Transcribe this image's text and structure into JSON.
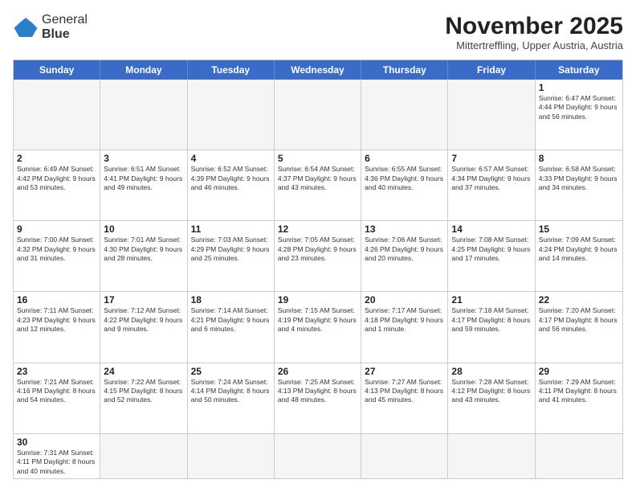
{
  "header": {
    "logo_line1": "General",
    "logo_line2": "Blue",
    "month_title": "November 2025",
    "subtitle": "Mittertreffling, Upper Austria, Austria"
  },
  "days_of_week": [
    "Sunday",
    "Monday",
    "Tuesday",
    "Wednesday",
    "Thursday",
    "Friday",
    "Saturday"
  ],
  "weeks": [
    [
      {
        "num": "",
        "info": ""
      },
      {
        "num": "",
        "info": ""
      },
      {
        "num": "",
        "info": ""
      },
      {
        "num": "",
        "info": ""
      },
      {
        "num": "",
        "info": ""
      },
      {
        "num": "",
        "info": ""
      },
      {
        "num": "1",
        "info": "Sunrise: 6:47 AM\nSunset: 4:44 PM\nDaylight: 9 hours and 56 minutes."
      }
    ],
    [
      {
        "num": "2",
        "info": "Sunrise: 6:49 AM\nSunset: 4:42 PM\nDaylight: 9 hours and 53 minutes."
      },
      {
        "num": "3",
        "info": "Sunrise: 6:51 AM\nSunset: 4:41 PM\nDaylight: 9 hours and 49 minutes."
      },
      {
        "num": "4",
        "info": "Sunrise: 6:52 AM\nSunset: 4:39 PM\nDaylight: 9 hours and 46 minutes."
      },
      {
        "num": "5",
        "info": "Sunrise: 6:54 AM\nSunset: 4:37 PM\nDaylight: 9 hours and 43 minutes."
      },
      {
        "num": "6",
        "info": "Sunrise: 6:55 AM\nSunset: 4:36 PM\nDaylight: 9 hours and 40 minutes."
      },
      {
        "num": "7",
        "info": "Sunrise: 6:57 AM\nSunset: 4:34 PM\nDaylight: 9 hours and 37 minutes."
      },
      {
        "num": "8",
        "info": "Sunrise: 6:58 AM\nSunset: 4:33 PM\nDaylight: 9 hours and 34 minutes."
      }
    ],
    [
      {
        "num": "9",
        "info": "Sunrise: 7:00 AM\nSunset: 4:32 PM\nDaylight: 9 hours and 31 minutes."
      },
      {
        "num": "10",
        "info": "Sunrise: 7:01 AM\nSunset: 4:30 PM\nDaylight: 9 hours and 28 minutes."
      },
      {
        "num": "11",
        "info": "Sunrise: 7:03 AM\nSunset: 4:29 PM\nDaylight: 9 hours and 25 minutes."
      },
      {
        "num": "12",
        "info": "Sunrise: 7:05 AM\nSunset: 4:28 PM\nDaylight: 9 hours and 23 minutes."
      },
      {
        "num": "13",
        "info": "Sunrise: 7:06 AM\nSunset: 4:26 PM\nDaylight: 9 hours and 20 minutes."
      },
      {
        "num": "14",
        "info": "Sunrise: 7:08 AM\nSunset: 4:25 PM\nDaylight: 9 hours and 17 minutes."
      },
      {
        "num": "15",
        "info": "Sunrise: 7:09 AM\nSunset: 4:24 PM\nDaylight: 9 hours and 14 minutes."
      }
    ],
    [
      {
        "num": "16",
        "info": "Sunrise: 7:11 AM\nSunset: 4:23 PM\nDaylight: 9 hours and 12 minutes."
      },
      {
        "num": "17",
        "info": "Sunrise: 7:12 AM\nSunset: 4:22 PM\nDaylight: 9 hours and 9 minutes."
      },
      {
        "num": "18",
        "info": "Sunrise: 7:14 AM\nSunset: 4:21 PM\nDaylight: 9 hours and 6 minutes."
      },
      {
        "num": "19",
        "info": "Sunrise: 7:15 AM\nSunset: 4:19 PM\nDaylight: 9 hours and 4 minutes."
      },
      {
        "num": "20",
        "info": "Sunrise: 7:17 AM\nSunset: 4:18 PM\nDaylight: 9 hours and 1 minute."
      },
      {
        "num": "21",
        "info": "Sunrise: 7:18 AM\nSunset: 4:17 PM\nDaylight: 8 hours and 59 minutes."
      },
      {
        "num": "22",
        "info": "Sunrise: 7:20 AM\nSunset: 4:17 PM\nDaylight: 8 hours and 56 minutes."
      }
    ],
    [
      {
        "num": "23",
        "info": "Sunrise: 7:21 AM\nSunset: 4:16 PM\nDaylight: 8 hours and 54 minutes."
      },
      {
        "num": "24",
        "info": "Sunrise: 7:22 AM\nSunset: 4:15 PM\nDaylight: 8 hours and 52 minutes."
      },
      {
        "num": "25",
        "info": "Sunrise: 7:24 AM\nSunset: 4:14 PM\nDaylight: 8 hours and 50 minutes."
      },
      {
        "num": "26",
        "info": "Sunrise: 7:25 AM\nSunset: 4:13 PM\nDaylight: 8 hours and 48 minutes."
      },
      {
        "num": "27",
        "info": "Sunrise: 7:27 AM\nSunset: 4:13 PM\nDaylight: 8 hours and 45 minutes."
      },
      {
        "num": "28",
        "info": "Sunrise: 7:28 AM\nSunset: 4:12 PM\nDaylight: 8 hours and 43 minutes."
      },
      {
        "num": "29",
        "info": "Sunrise: 7:29 AM\nSunset: 4:11 PM\nDaylight: 8 hours and 41 minutes."
      }
    ],
    [
      {
        "num": "30",
        "info": "Sunrise: 7:31 AM\nSunset: 4:11 PM\nDaylight: 8 hours and 40 minutes."
      },
      {
        "num": "",
        "info": ""
      },
      {
        "num": "",
        "info": ""
      },
      {
        "num": "",
        "info": ""
      },
      {
        "num": "",
        "info": ""
      },
      {
        "num": "",
        "info": ""
      },
      {
        "num": "",
        "info": ""
      }
    ]
  ],
  "colors": {
    "header_bg": "#3a6bc9",
    "header_text": "#ffffff",
    "cell_border": "#cccccc",
    "empty_bg": "#f5f5f5"
  }
}
